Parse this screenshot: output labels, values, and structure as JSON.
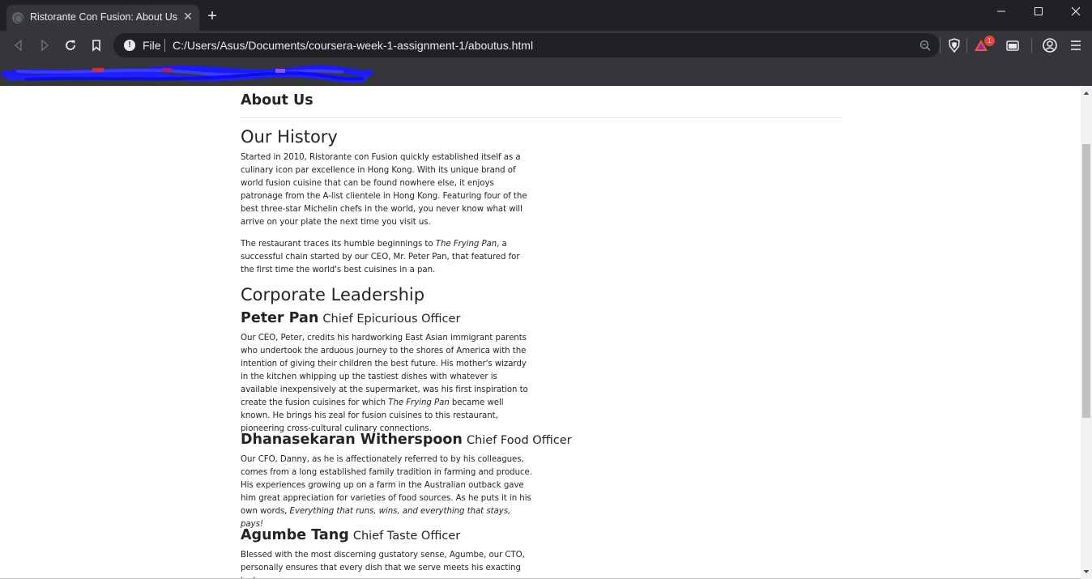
{
  "browser": {
    "tab_title": "Ristorante Con Fusion: About Us",
    "new_tab_label": "+",
    "close_tab_label": "✕",
    "omnibox": {
      "scheme": "File",
      "url": "C:/Users/Asus/Documents/coursera-week-1-assignment-1/aboutus.html"
    },
    "notification_badge": "1",
    "bookmarks_redacted": true
  },
  "page": {
    "heading": "About Us",
    "history": {
      "title": "Our History",
      "paragraph1": "Started in 2010, Ristorante con Fusion quickly established itself as a culinary icon par excellence in Hong Kong. With its unique brand of world fusion cuisine that can be found nowhere else, it enjoys patronage from the A-list clientele in Hong Kong. Featuring four of the best three-star Michelin chefs in the world, you never know what will arrive on your plate the next time you visit us.",
      "paragraph2_before": "The restaurant traces its humble beginnings to ",
      "paragraph2_em": "The Frying Pan",
      "paragraph2_after": ", a successful chain started by our CEO, Mr. Peter Pan, that featured for the first time the world's best cuisines in a pan."
    },
    "leadership": {
      "title": "Corporate Leadership",
      "people": [
        {
          "name": "Peter Pan",
          "role": "Chief Epicurious Officer",
          "bio_before": "Our CEO, Peter, credits his hardworking East Asian immigrant parents who undertook the arduous journey to the shores of America with the intention of giving their children the best future. His mother's wizardy in the kitchen whipping up the tastiest dishes with whatever is available inexpensively at the supermarket, was his first inspiration to create the fusion cuisines for which ",
          "bio_em": "The Frying Pan",
          "bio_after": " became well known. He brings his zeal for fusion cuisines to this restaurant, pioneering cross-cultural culinary connections."
        },
        {
          "name": "Dhanasekaran Witherspoon",
          "role": "Chief Food Officer",
          "bio_before": "Our CFO, Danny, as he is affectionately referred to by his colleagues, comes from a long established family tradition in farming and produce. His experiences growing up on a farm in the Australian outback gave him great appreciation for varieties of food sources. As he puts it in his own words, ",
          "bio_em": "Everything that runs, wins, and everything that stays, pays!",
          "bio_after": ""
        },
        {
          "name": "Agumbe Tang",
          "role": "Chief Taste Officer",
          "bio_before": "Blessed with the most discerning gustatory sense, Agumbe, our CTO, personally ensures that every dish that we serve meets his exacting tastes.",
          "bio_em": "",
          "bio_after": ""
        }
      ]
    }
  },
  "colors": {
    "chrome_dark": "#202124",
    "chrome_tab": "#35363a",
    "text": "#212529",
    "rule": "#e6e6e6",
    "brave_orange": "#fb542b",
    "badge_red": "#e8453c",
    "redaction_blue": "#1a1aff"
  }
}
